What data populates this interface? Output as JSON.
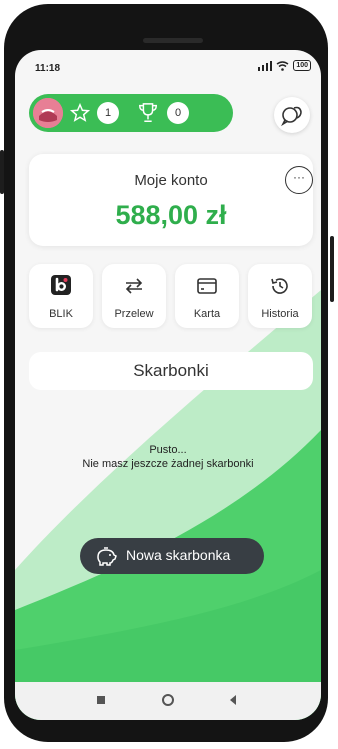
{
  "status_bar": {
    "time": "11:18",
    "battery": "100"
  },
  "header": {
    "stars_count": "1",
    "trophies_count": "0"
  },
  "account": {
    "title": "Moje konto",
    "balance": "588,00 zł",
    "more_glyph": "···"
  },
  "actions": [
    {
      "label": "BLIK",
      "icon": "blik-icon"
    },
    {
      "label": "Przelew",
      "icon": "transfer-icon"
    },
    {
      "label": "Karta",
      "icon": "card-icon"
    },
    {
      "label": "Historia",
      "icon": "history-icon"
    }
  ],
  "savings": {
    "title": "Skarbonki",
    "empty_title": "Pusto...",
    "empty_message": "Nie masz jeszcze żadnej skarbonki",
    "new_button_label": "Nowa skarbonka"
  },
  "colors": {
    "accent_green": "#3bbd55",
    "balance_green": "#2fae4c",
    "dark_button": "#383e44"
  }
}
